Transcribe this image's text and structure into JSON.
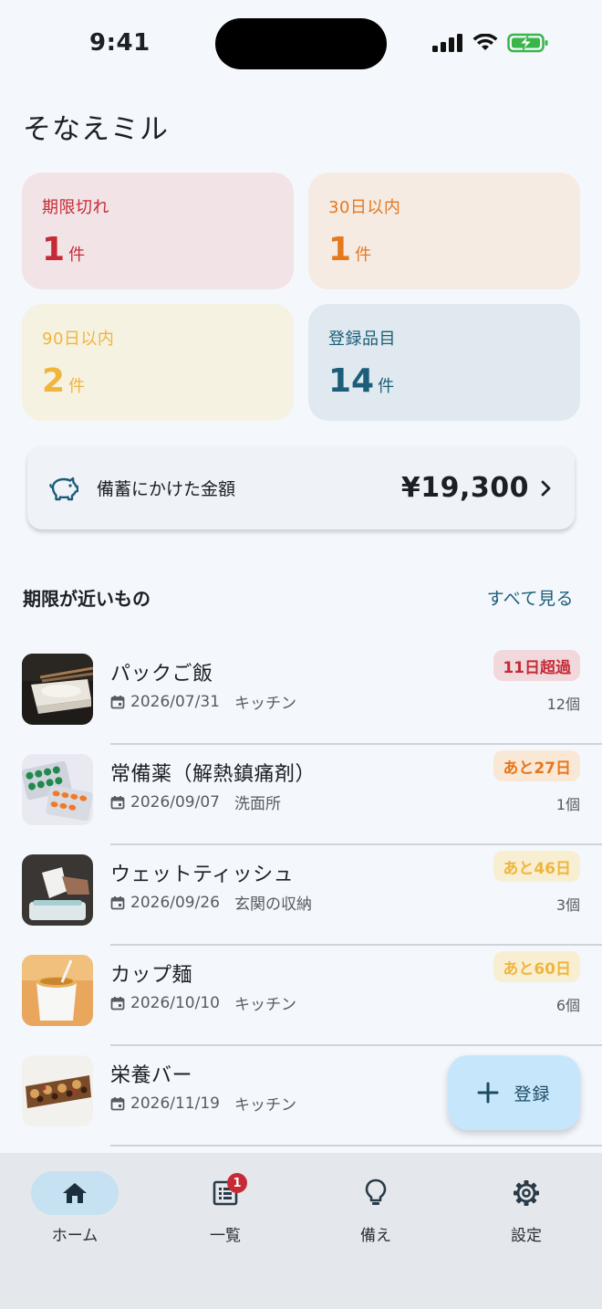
{
  "status_bar": {
    "time": "9:41"
  },
  "app": {
    "title": "そなえミル"
  },
  "stats": [
    {
      "label": "期限切れ",
      "value": "1",
      "unit": "件",
      "color": "#c62b35"
    },
    {
      "label": "30日以内",
      "value": "1",
      "unit": "件",
      "color": "#e6781e"
    },
    {
      "label": "90日以内",
      "value": "2",
      "unit": "件",
      "color": "#f0b53c"
    },
    {
      "label": "登録品目",
      "value": "14",
      "unit": "件",
      "color": "#1c5d79"
    }
  ],
  "spending": {
    "label": "備蓄にかけた金額",
    "value": "¥19,300",
    "icon": "piggy-bank-icon"
  },
  "section": {
    "title": "期限が近いもの",
    "link": "すべて見る"
  },
  "items": [
    {
      "name": "パックご飯",
      "date": "2026/07/31",
      "location": "キッチン",
      "badge": "11日超過",
      "qty": "12個",
      "status": "expired"
    },
    {
      "name": "常備薬（解熱鎮痛剤）",
      "date": "2026/09/07",
      "location": "洗面所",
      "badge": "あと27日",
      "qty": "1個",
      "status": "soon"
    },
    {
      "name": "ウェットティッシュ",
      "date": "2026/09/26",
      "location": "玄関の収納",
      "badge": "あと46日",
      "qty": "3個",
      "status": "later"
    },
    {
      "name": "カップ麺",
      "date": "2026/10/10",
      "location": "キッチン",
      "badge": "あと60日",
      "qty": "6個",
      "status": "later"
    },
    {
      "name": "栄養バー",
      "date": "2026/11/19",
      "location": "キッチン",
      "badge": "",
      "qty": "",
      "status": "ok"
    }
  ],
  "fab": {
    "label": "登録",
    "icon": "plus-icon"
  },
  "nav": [
    {
      "label": "ホーム",
      "icon": "home-icon",
      "active": true
    },
    {
      "label": "一覧",
      "icon": "list-icon",
      "badge": "1"
    },
    {
      "label": "備え",
      "icon": "lightbulb-icon"
    },
    {
      "label": "設定",
      "icon": "gear-icon"
    }
  ]
}
